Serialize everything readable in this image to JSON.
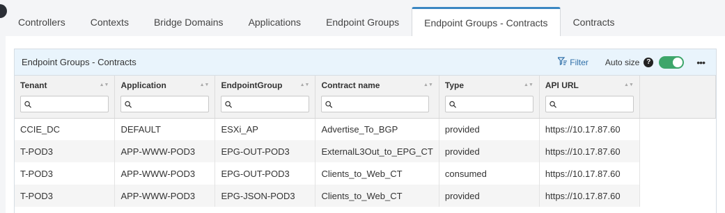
{
  "tabs": [
    {
      "label": "Controllers",
      "active": false
    },
    {
      "label": "Contexts",
      "active": false
    },
    {
      "label": "Bridge Domains",
      "active": false
    },
    {
      "label": "Applications",
      "active": false
    },
    {
      "label": "Endpoint Groups",
      "active": false
    },
    {
      "label": "Endpoint Groups - Contracts",
      "active": true
    },
    {
      "label": "Contracts",
      "active": false
    }
  ],
  "widget": {
    "title": "Endpoint Groups - Contracts",
    "filter_label": "Filter",
    "autosize_label": "Auto size",
    "help_glyph": "?",
    "autosize_on": true,
    "more_glyph": "•••"
  },
  "table": {
    "columns": [
      "Tenant",
      "Application",
      "EndpointGroup",
      "Contract name",
      "Type",
      "API URL"
    ],
    "rows": [
      [
        "CCIE_DC",
        "DEFAULT",
        "ESXi_AP",
        "Advertise_To_BGP",
        "provided",
        "https://10.17.87.60"
      ],
      [
        "T-POD3",
        "APP-WWW-POD3",
        "EPG-OUT-POD3",
        "ExternalL3Out_to_EPG_CT",
        "provided",
        "https://10.17.87.60"
      ],
      [
        "T-POD3",
        "APP-WWW-POD3",
        "EPG-OUT-POD3",
        "Clients_to_Web_CT",
        "consumed",
        "https://10.17.87.60"
      ],
      [
        "T-POD3",
        "APP-WWW-POD3",
        "EPG-JSON-POD3",
        "Clients_to_Web_CT",
        "provided",
        "https://10.17.87.60"
      ]
    ]
  },
  "colors": {
    "accent": "#3a87c2",
    "toggle_on": "#3da66a",
    "header_bg": "#e9f4fc",
    "link": "#2f6fa8"
  }
}
